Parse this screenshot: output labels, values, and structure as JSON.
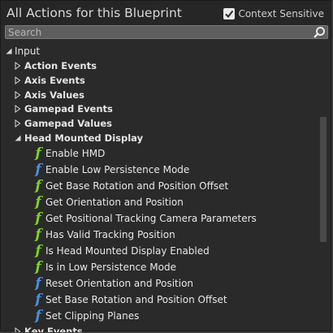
{
  "header": {
    "title": "All Actions for this Blueprint",
    "context_sensitive_label": "Context Sensitive",
    "context_sensitive_checked": true
  },
  "search": {
    "placeholder": "Search",
    "value": ""
  },
  "tree": {
    "root": {
      "label": "Input",
      "expanded": true
    },
    "categories": [
      {
        "label": "Action Events",
        "expanded": false
      },
      {
        "label": "Axis Events",
        "expanded": false
      },
      {
        "label": "Axis Values",
        "expanded": false
      },
      {
        "label": "Gamepad Events",
        "expanded": false
      },
      {
        "label": "Gamepad Values",
        "expanded": false
      },
      {
        "label": "Head Mounted Display",
        "expanded": true
      }
    ],
    "functions": [
      {
        "label": "Enable HMD",
        "icon": "function-icon",
        "color": "#7ed321"
      },
      {
        "label": "Enable Low Persistence Mode",
        "icon": "function-icon",
        "color": "#4a90e2"
      },
      {
        "label": "Get Base Rotation and Position Offset",
        "icon": "function-icon",
        "color": "#7ed321"
      },
      {
        "label": "Get Orientation and Position",
        "icon": "function-icon",
        "color": "#7ed321"
      },
      {
        "label": "Get Positional Tracking Camera Parameters",
        "icon": "function-icon",
        "color": "#7ed321"
      },
      {
        "label": "Has Valid Tracking Position",
        "icon": "function-icon",
        "color": "#7ed321"
      },
      {
        "label": "Is Head Mounted Display Enabled",
        "icon": "function-icon",
        "color": "#7ed321"
      },
      {
        "label": "Is in Low Persistence Mode",
        "icon": "function-icon",
        "color": "#7ed321"
      },
      {
        "label": "Reset Orientation and Position",
        "icon": "function-icon",
        "color": "#4a90e2"
      },
      {
        "label": "Set Base Rotation and Position Offset",
        "icon": "function-icon",
        "color": "#4a90e2"
      },
      {
        "label": "Set Clipping Planes",
        "icon": "function-icon",
        "color": "#4a90e2"
      }
    ],
    "partial_category": {
      "label": "Key Events"
    }
  },
  "colors": {
    "window_bg": "#2a2a2a",
    "titlebar_bg": "#262626",
    "search_bg": "#5e5e5e",
    "pure_function": "#7ed321",
    "impure_function": "#4a90e2"
  }
}
